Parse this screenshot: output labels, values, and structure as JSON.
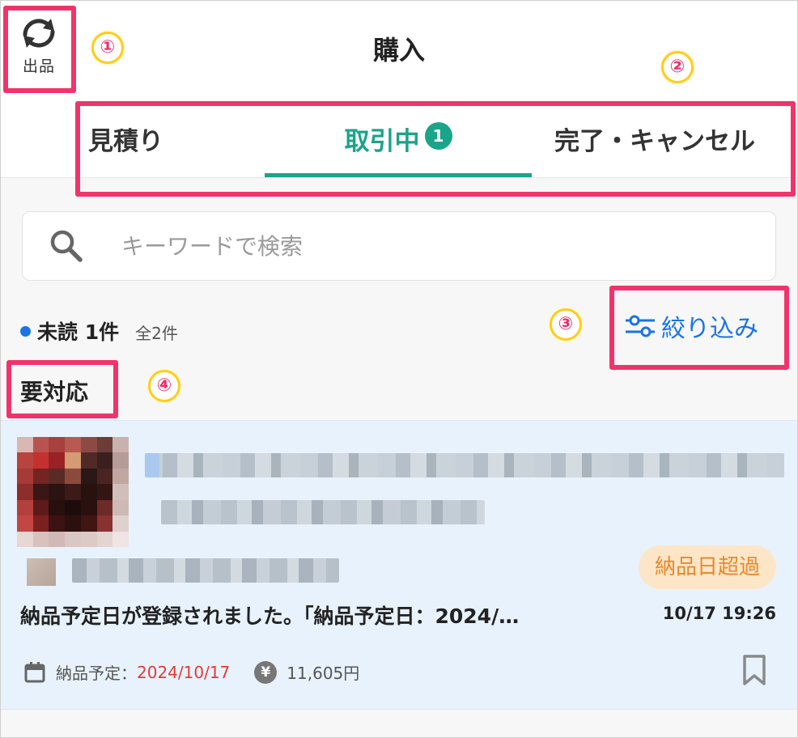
{
  "header": {
    "switch_label": "出品",
    "title": "購入"
  },
  "tabs": [
    {
      "label": "見積り"
    },
    {
      "label": "取引中",
      "badge": "1"
    },
    {
      "label": "完了・キャンセル"
    }
  ],
  "search": {
    "placeholder": "キーワードで検索"
  },
  "filter_row": {
    "unread": "未読 1件",
    "total": "全2件",
    "filter_label": "絞り込み"
  },
  "section": {
    "label": "要対応"
  },
  "card": {
    "status_badge": "納品日超過",
    "message": "納品予定日が登録されました。「納品予定日：2024/…",
    "time": "10/17 19:26",
    "due_label": "納品予定：",
    "due_date": "2024/10/17",
    "yen_symbol": "¥",
    "price": "11,605円"
  },
  "annotations": [
    "①",
    "②",
    "③",
    "④"
  ],
  "colors": {
    "accent_green": "#1aa489",
    "link_blue": "#1a73e8",
    "annotation_pink": "#f0346b",
    "overdue_orange": "#e8892a",
    "due_red": "#e53935"
  }
}
